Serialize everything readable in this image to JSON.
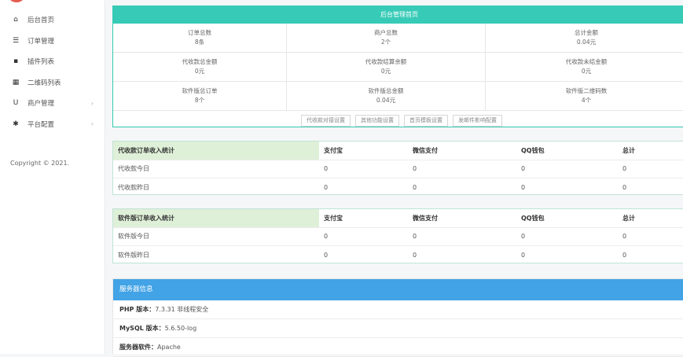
{
  "sidebar": {
    "items": [
      {
        "label": "后台首页",
        "icon": "home-icon",
        "glyph": "⌂",
        "arrow": false
      },
      {
        "label": "订单管理",
        "icon": "list-icon",
        "glyph": "☰",
        "arrow": false
      },
      {
        "label": "插件列表",
        "icon": "plugin-icon",
        "glyph": "▪",
        "arrow": false
      },
      {
        "label": "二维码列表",
        "icon": "qrcode-icon",
        "glyph": "▦",
        "arrow": false
      },
      {
        "label": "商户管理",
        "icon": "user-icon",
        "glyph": "U",
        "arrow": true
      },
      {
        "label": "平台配置",
        "icon": "gear-icon",
        "glyph": "✱",
        "arrow": true
      }
    ],
    "arrow_glyph": "›",
    "copyright": "Copyright © 2021."
  },
  "overview": {
    "title": "后台管理首页",
    "stats": [
      {
        "label": "订单总数",
        "value": "8条"
      },
      {
        "label": "商户总数",
        "value": "2个"
      },
      {
        "label": "总计金额",
        "value": "0.04元"
      },
      {
        "label": "代收款总金额",
        "value": "0元"
      },
      {
        "label": "代收款结算余额",
        "value": "0元"
      },
      {
        "label": "代收款未结金额",
        "value": "0元"
      },
      {
        "label": "软件版总订单",
        "value": "8个"
      },
      {
        "label": "软件版总金额",
        "value": "0.04元"
      },
      {
        "label": "软件版二维码数",
        "value": "4个"
      }
    ],
    "buttons": [
      "代收款对接设置",
      "其他功能设置",
      "首页模板设置",
      "发邮件影响配置"
    ]
  },
  "table1": {
    "headers": [
      "代收款订单收入统计",
      "支付宝",
      "微信支付",
      "QQ钱包",
      "总计"
    ],
    "rows": [
      [
        "代收款今日",
        "0",
        "0",
        "0",
        "0"
      ],
      [
        "代收款昨日",
        "0",
        "0",
        "0",
        "0"
      ]
    ]
  },
  "table2": {
    "headers": [
      "软件版订单收入统计",
      "支付宝",
      "微信支付",
      "QQ钱包",
      "总计"
    ],
    "rows": [
      [
        "软件版今日",
        "0",
        "0",
        "0",
        "0"
      ],
      [
        "软件版昨日",
        "0",
        "0",
        "0",
        "0"
      ]
    ]
  },
  "server": {
    "title": "服务器信息",
    "rows": [
      {
        "key": "PHP 版本：",
        "value": "7.3.31 非线程安全"
      },
      {
        "key": "MySQL 版本：",
        "value": "5.6.50-log"
      },
      {
        "key": "服务器软件：",
        "value": "Apache"
      }
    ]
  },
  "colors": {
    "teal_header": "#37cbb7",
    "blue_header": "#42a3e6",
    "green_cell": "#dff0d8"
  }
}
